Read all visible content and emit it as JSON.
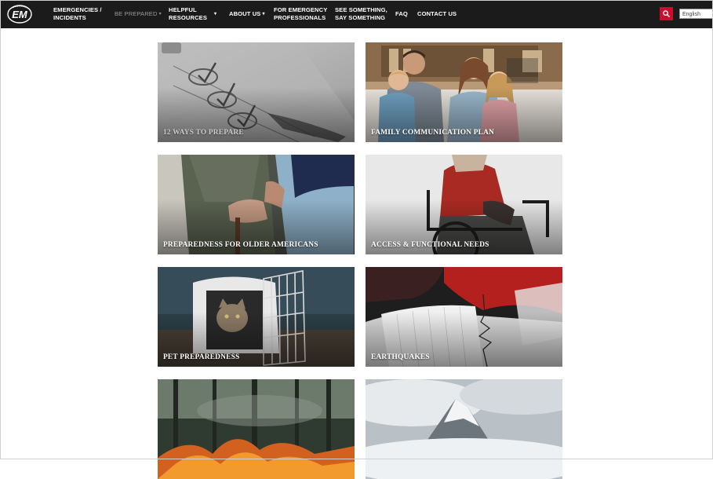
{
  "nav": {
    "logo_text": "EM",
    "items": [
      {
        "label_1": "EMERGENCIES /",
        "label_2": "INCIDENTS"
      },
      {
        "label_1": "BE PREPARED",
        "label_2": ""
      },
      {
        "label_1": "HELPFUL",
        "label_2": "RESOURCES"
      },
      {
        "label_1": "ABOUT US",
        "label_2": ""
      },
      {
        "label_1": "FOR EMERGENCY",
        "label_2": "PROFESSIONALS"
      },
      {
        "label_1": "SEE SOMETHING,",
        "label_2": "SAY SOMETHING"
      },
      {
        "label_1": "FAQ",
        "label_2": ""
      },
      {
        "label_1": "CONTACT US",
        "label_2": ""
      }
    ],
    "search_icon": "search-icon",
    "language": "English"
  },
  "tiles": [
    {
      "label": "12 WAYS TO PREPARE"
    },
    {
      "label": "FAMILY COMMUNICATION PLAN"
    },
    {
      "label": "PREPAREDNESS FOR OLDER AMERICANS"
    },
    {
      "label": "ACCESS & FUNCTIONAL NEEDS"
    },
    {
      "label": "PET PREPAREDNESS"
    },
    {
      "label": "EARTHQUAKES"
    },
    {
      "label": ""
    },
    {
      "label": ""
    }
  ],
  "colors": {
    "navbar_bg": "#1b1b1b",
    "search_accent": "#c8102e",
    "page_bg": "#ffffff"
  }
}
